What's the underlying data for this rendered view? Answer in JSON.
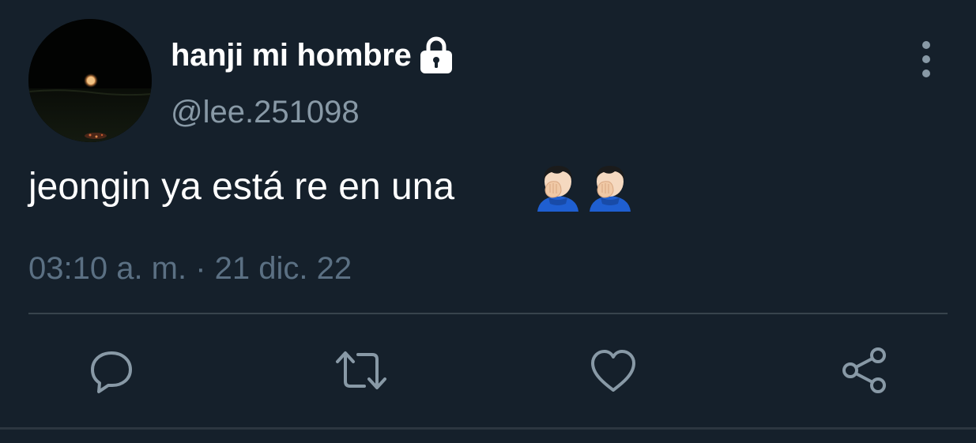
{
  "tweet": {
    "display_name": "hanji mi hombre",
    "handle": "@lee.251098",
    "text": "jeongin ya está re en una",
    "emojis": [
      "facepalm-icon",
      "facepalm-icon"
    ],
    "timestamp": "03:10 a. m. · 21 dic. 22",
    "protected": true
  },
  "icons": {
    "lock": "lock-icon",
    "more": "more-vertical-icon",
    "reply": "reply-icon",
    "retweet": "retweet-icon",
    "like": "heart-icon",
    "share": "share-icon"
  },
  "colors": {
    "background": "#15202b",
    "primary_text": "#ffffff",
    "secondary_text": "#8899a6",
    "timestamp_text": "#5b7083",
    "divider": "#38444d",
    "icon": "#8899a6"
  }
}
